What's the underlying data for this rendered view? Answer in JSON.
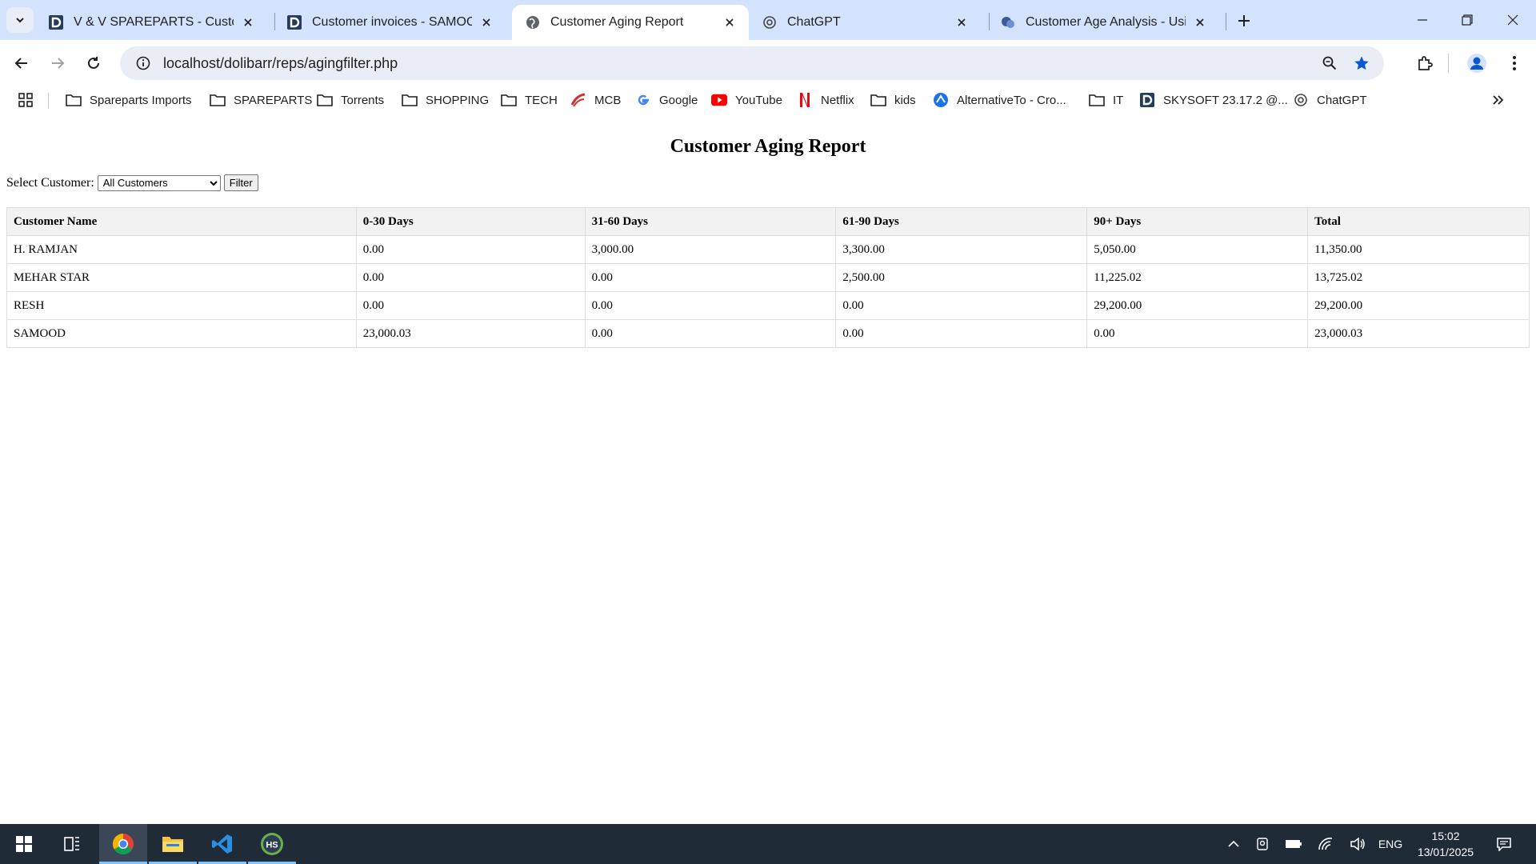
{
  "browser": {
    "tabs": [
      {
        "title": "V & V SPAREPARTS - Customer",
        "icon": "dolibarr-icon",
        "active": false
      },
      {
        "title": "Customer invoices - SAMOOD",
        "icon": "dolibarr-icon",
        "active": false
      },
      {
        "title": "Customer Aging Report",
        "icon": "globe-icon",
        "active": true
      },
      {
        "title": "ChatGPT",
        "icon": "chatgpt-icon",
        "active": false
      },
      {
        "title": "Customer Age Analysis - Using",
        "icon": "copilot-icon",
        "active": false
      }
    ],
    "url": "localhost/dolibarr/reps/agingfilter.php",
    "bookmarks": [
      {
        "label": "Spareparts Imports",
        "icon": "folder-icon"
      },
      {
        "label": "SPAREPARTS",
        "icon": "folder-icon"
      },
      {
        "label": "Torrents",
        "icon": "folder-icon"
      },
      {
        "label": "SHOPPING",
        "icon": "folder-icon"
      },
      {
        "label": "TECH",
        "icon": "folder-icon"
      },
      {
        "label": "MCB",
        "icon": "mcb-icon"
      },
      {
        "label": "Google",
        "icon": "google-icon"
      },
      {
        "label": "YouTube",
        "icon": "youtube-icon"
      },
      {
        "label": "Netflix",
        "icon": "netflix-icon"
      },
      {
        "label": "kids",
        "icon": "folder-icon"
      },
      {
        "label": "AlternativeTo - Cro...",
        "icon": "alternativeto-icon"
      },
      {
        "label": "IT",
        "icon": "folder-icon"
      },
      {
        "label": "SKYSOFT 23.17.2 @...",
        "icon": "dolibarr-icon"
      },
      {
        "label": "ChatGPT",
        "icon": "chatgpt-icon"
      }
    ]
  },
  "page": {
    "title": "Customer Aging Report",
    "filter": {
      "label": "Select Customer:",
      "selected": "All Customers",
      "button": "Filter"
    },
    "table": {
      "headers": [
        "Customer Name",
        "0-30 Days",
        "31-60 Days",
        "61-90 Days",
        "90+ Days",
        "Total"
      ],
      "rows": [
        [
          "H. RAMJAN",
          "0.00",
          "3,000.00",
          "3,300.00",
          "5,050.00",
          "11,350.00"
        ],
        [
          "MEHAR STAR",
          "0.00",
          "0.00",
          "2,500.00",
          "11,225.02",
          "13,725.02"
        ],
        [
          "RESH",
          "0.00",
          "0.00",
          "0.00",
          "29,200.00",
          "29,200.00"
        ],
        [
          "SAMOOD",
          "23,000.03",
          "0.00",
          "0.00",
          "0.00",
          "23,000.03"
        ]
      ]
    }
  },
  "taskbar": {
    "language": "ENG",
    "time": "15:02",
    "date": "13/01/2025",
    "apps": [
      "windows-start-icon",
      "task-view-icon",
      "chrome-icon",
      "file-explorer-icon",
      "vscode-icon",
      "hs-app-icon"
    ]
  },
  "colors": {
    "tabstrip": "#d3e3fd",
    "omnibox": "#e9eef6",
    "table_header": "#f2f2f2",
    "taskbar": "#202b38",
    "accent": "#0b57d0"
  }
}
